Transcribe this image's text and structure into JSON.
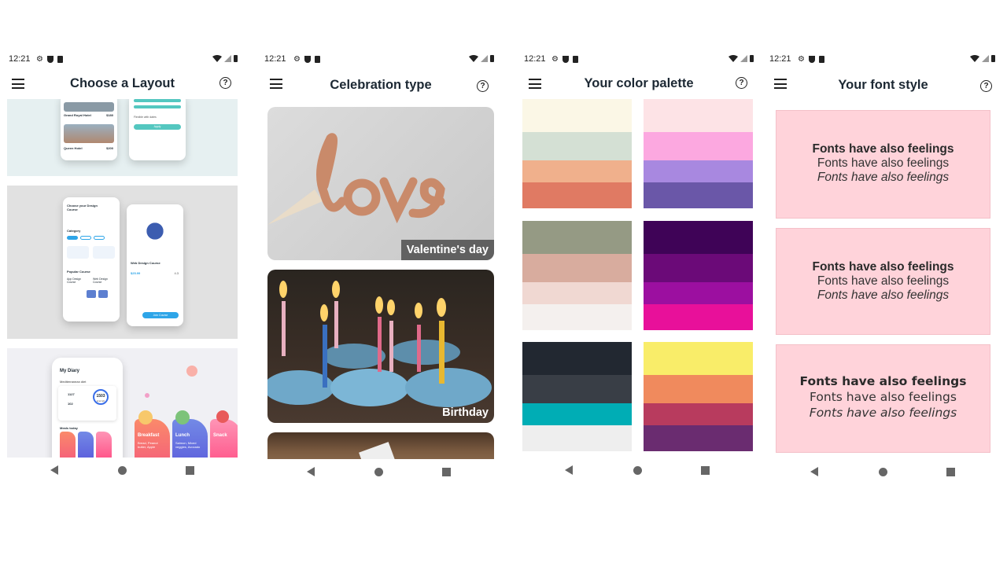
{
  "status": {
    "time": "12:21"
  },
  "screens": {
    "layout": {
      "title": "Choose a Layout"
    },
    "celebration": {
      "title": "Celebration type",
      "cards": [
        {
          "label": "Valentine's day",
          "image_text": "love"
        },
        {
          "label": "Birthday"
        },
        {
          "label": ""
        }
      ]
    },
    "palette": {
      "title": "Your color palette",
      "palettes": [
        [
          "#fbf7e6",
          "#d4e0d4",
          "#f0b08c",
          "#e07a63"
        ],
        [
          "#fde3e6",
          "#fca8e0",
          "#a888e0",
          "#6a57a8"
        ],
        [
          "#959a84",
          "#d8ac9e",
          "#f0d8d2",
          "#f4f0ee"
        ],
        [
          "#3f0357",
          "#6b0a78",
          "#9c0fa0",
          "#e8109a"
        ],
        [
          "#222831",
          "#393e46",
          "#00adb5",
          "#eeeeee"
        ],
        [
          "#f9ed69",
          "#f08a5d",
          "#b83b5e",
          "#6a2c70"
        ]
      ]
    },
    "fonts": {
      "title": "Your font style",
      "sample": "Fonts have also feelings"
    }
  },
  "mockups": {
    "hotel": {
      "name1": "Grand Royal Hotel",
      "price1": "$180",
      "name2": "Queen Hotel",
      "price2": "$200",
      "check_label": "Flexible with dates",
      "button": "Apply"
    },
    "course": {
      "heading": "Choose your Design Course",
      "category": "Category",
      "popular": "Popular Course",
      "course1": "App Design Course",
      "course2": "Web Design Course",
      "detail_title": "Web Design Course",
      "detail_price": "$25.99",
      "detail_rating": "4.3",
      "detail_button": "Join Course"
    },
    "diary": {
      "title": "My Diary",
      "subtitle": "Mediterranean diet",
      "kcal": "1503",
      "kcal_label": "kcal left",
      "eaten": "1127",
      "burned": "102",
      "meals_label": "Meals today",
      "breakfast": "Breakfast",
      "breakfast_items": "Bread, Peanut butter, Apple",
      "lunch": "Lunch",
      "lunch_items": "Salmon, Mixed veggies, Avocado",
      "snack": "Snack"
    }
  }
}
